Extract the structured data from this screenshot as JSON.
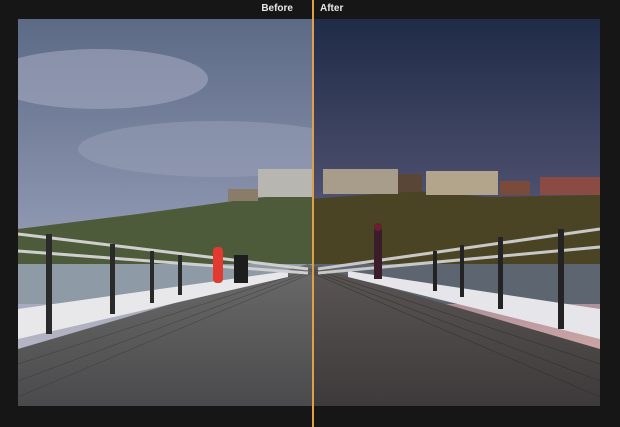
{
  "compare": {
    "before_label": "Before",
    "after_label": "After",
    "divider_color": "#e0a04a"
  },
  "photo": {
    "left_grade": "cool-flat",
    "right_grade": "warm-contrast"
  }
}
